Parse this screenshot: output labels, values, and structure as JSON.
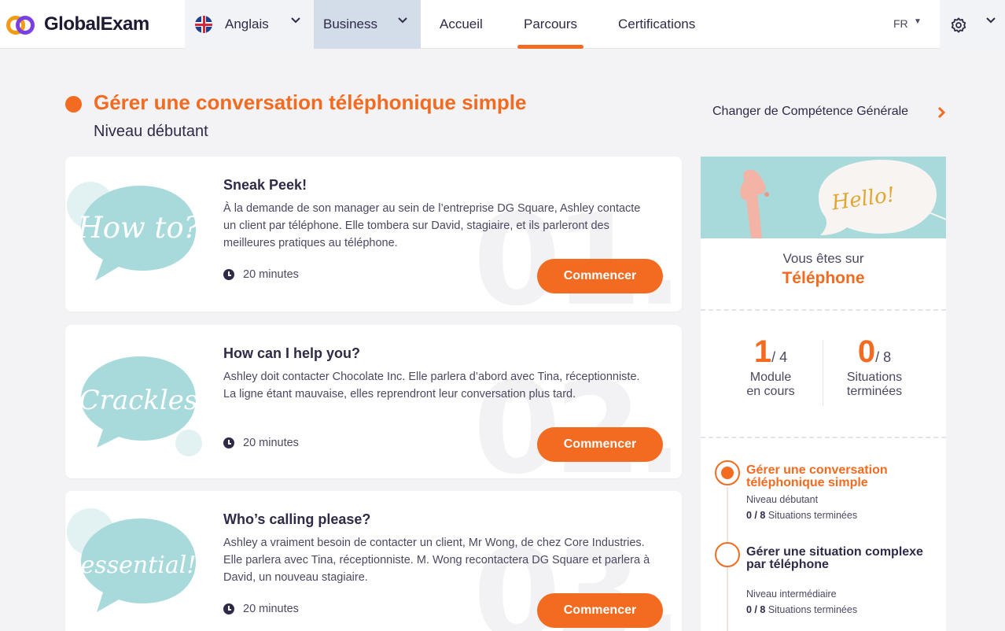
{
  "topbar": {
    "brand": "GlobalExam",
    "language": "Anglais",
    "track": "Business",
    "nav": [
      "Accueil",
      "Parcours",
      "Certifications"
    ],
    "active_nav": "Parcours",
    "locale": "FR"
  },
  "header": {
    "title": "Gérer une conversation téléphonique simple",
    "level": "Niveau débutant",
    "change_link": "Changer de Compétence Générale"
  },
  "modules": [
    {
      "title": "Sneak Peek!",
      "description": "À la demande de son manager au sein de l’entreprise DG Square, Ashley contacte un client par téléphone. Elle tombera sur David, stagiaire, et ils parleront des meilleures pratiques au téléphone.",
      "duration": "20 minutes",
      "button": "Commencer",
      "bubble_text": "How to?",
      "number": "01."
    },
    {
      "title": "How can I help you?",
      "description": "Ashley doit contacter Chocolate Inc. Elle parlera d’abord avec Tina, réceptionniste. La ligne étant mauvaise, elles reprendront leur conversation plus tard.",
      "duration": "20 minutes",
      "button": "Commencer",
      "bubble_text": "Crackles",
      "number": "02."
    },
    {
      "title": "Who’s calling please?",
      "description": "Ashley a vraiment besoin de contacter un client, Mr Wong, de chez Core Industries. Elle parlera avec Tina, réceptionniste. M. Wong recontactera DG Square et parlera à David, un nouveau stagiaire.",
      "duration": "20 minutes",
      "button": "Commencer",
      "bubble_text": "essential!",
      "number": "03."
    }
  ],
  "panel": {
    "hero_text": "Hello!",
    "you_are_on": "Vous êtes sur",
    "topic": "Téléphone",
    "stats": [
      {
        "value": "1",
        "total": "/ 4",
        "label_line1": "Module",
        "label_line2": "en cours"
      },
      {
        "value": "0",
        "total": "/ 8",
        "label_line1": "Situations",
        "label_line2": "terminées"
      }
    ],
    "steps": [
      {
        "title": "Gérer une conversation téléphonique simple",
        "level": "Niveau débutant",
        "progress": "0 / 8",
        "progress_label": "Situations terminées",
        "active": true
      },
      {
        "title": "Gérer une situation complexe par téléphone",
        "level": "Niveau intermédiaire",
        "progress": "0 / 8",
        "progress_label": "Situations terminées",
        "active": false
      }
    ]
  },
  "colors": {
    "accent": "#f26b21",
    "text": "#2e2a47",
    "bubble": "#a8dadc",
    "biz_tab": "#d3dde9"
  }
}
